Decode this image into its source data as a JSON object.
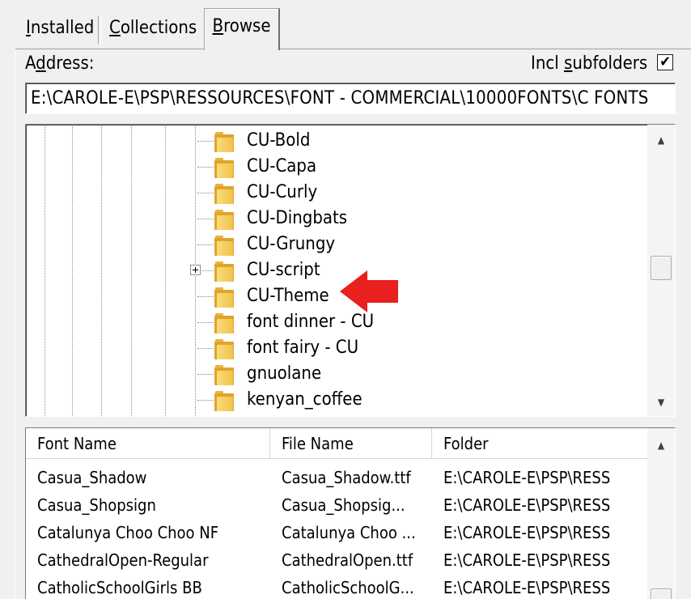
{
  "tabs": {
    "installed": {
      "pre": "",
      "accel": "I",
      "post": "nstalled"
    },
    "collections": {
      "pre": "",
      "accel": "C",
      "post": "ollections"
    },
    "browse": {
      "pre": "",
      "accel": "B",
      "post": "rowse"
    }
  },
  "address": {
    "label_pre": "A",
    "label_accel": "d",
    "label_post": "dress:",
    "value": "E:\\CAROLE-E\\PSP\\RESSOURCES\\FONT - COMMERCIAL\\10000FONTS\\C FONTS"
  },
  "subfolders": {
    "label_pre": "Incl ",
    "label_accel": "s",
    "label_post": "ubfolders",
    "checked": true,
    "check_glyph": "✔"
  },
  "tree": {
    "items": [
      {
        "label": "CU-Bold"
      },
      {
        "label": "CU-Capa"
      },
      {
        "label": "CU-Curly"
      },
      {
        "label": "CU-Dingbats"
      },
      {
        "label": "CU-Grungy"
      },
      {
        "label": "CU-script",
        "expandable": true
      },
      {
        "label": "CU-Theme"
      },
      {
        "label": "font dinner - CU"
      },
      {
        "label": "font fairy - CU"
      },
      {
        "label": "gnuolane"
      },
      {
        "label": "kenyan_coffee"
      }
    ]
  },
  "scroll_arrows": {
    "up": "▲",
    "down": "▼"
  },
  "annotation": {
    "arrow_color": "#e8201e",
    "points_to": "CU-Theme"
  },
  "table": {
    "headers": [
      "Font Name",
      "File Name",
      "Folder"
    ],
    "rows": [
      [
        "Casua_Shadow",
        "Casua_Shadow.ttf",
        "E:\\CAROLE-E\\PSP\\RESS"
      ],
      [
        "Casua_Shopsign",
        "Casua_Shopsig...",
        "E:\\CAROLE-E\\PSP\\RESS"
      ],
      [
        "Catalunya Choo Choo NF",
        "Catalunya Choo ...",
        "E:\\CAROLE-E\\PSP\\RESS"
      ],
      [
        "CathedralOpen-Regular",
        "CathedralOpen.ttf",
        "E:\\CAROLE-E\\PSP\\RESS"
      ],
      [
        "CatholicSchoolGirls BB",
        "CatholicSchoolG...",
        "E:\\CAROLE-E\\PSP\\RESS"
      ]
    ]
  }
}
